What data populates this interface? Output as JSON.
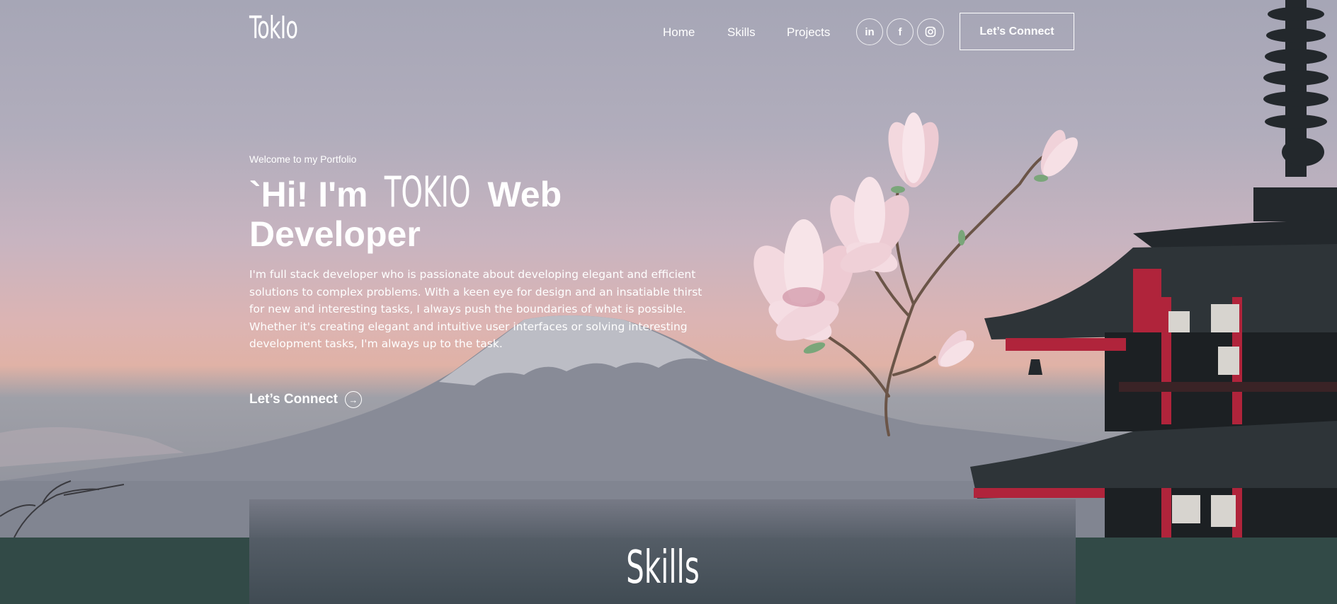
{
  "brand": {
    "logo": "TokIo"
  },
  "nav": {
    "links": [
      "Home",
      "Skills",
      "Projects"
    ],
    "social": [
      "linkedin-icon",
      "facebook-icon",
      "instagram-icon"
    ],
    "connect_label": "Let’s Connect"
  },
  "hero": {
    "welcome": "Welcome to my Portfolio",
    "headline_pre": "`Hi! I'm",
    "headline_name": "TOKIO",
    "headline_post": "Web Developer",
    "bio": "I'm full stack developer who is passionate about developing elegant and efficient solutions to complex problems. With a keen eye for design and an insatiable thirst for new and interesting tasks, I always push the boundaries of what is possible. Whether it's creating elegant and intuitive user interfaces or solving interesting development tasks, I'm always up to the task.",
    "cta_label": "Let’s Connect"
  },
  "skills": {
    "title": "Skills"
  },
  "colors": {
    "band": "#324a47",
    "accent": "#ffffff"
  }
}
